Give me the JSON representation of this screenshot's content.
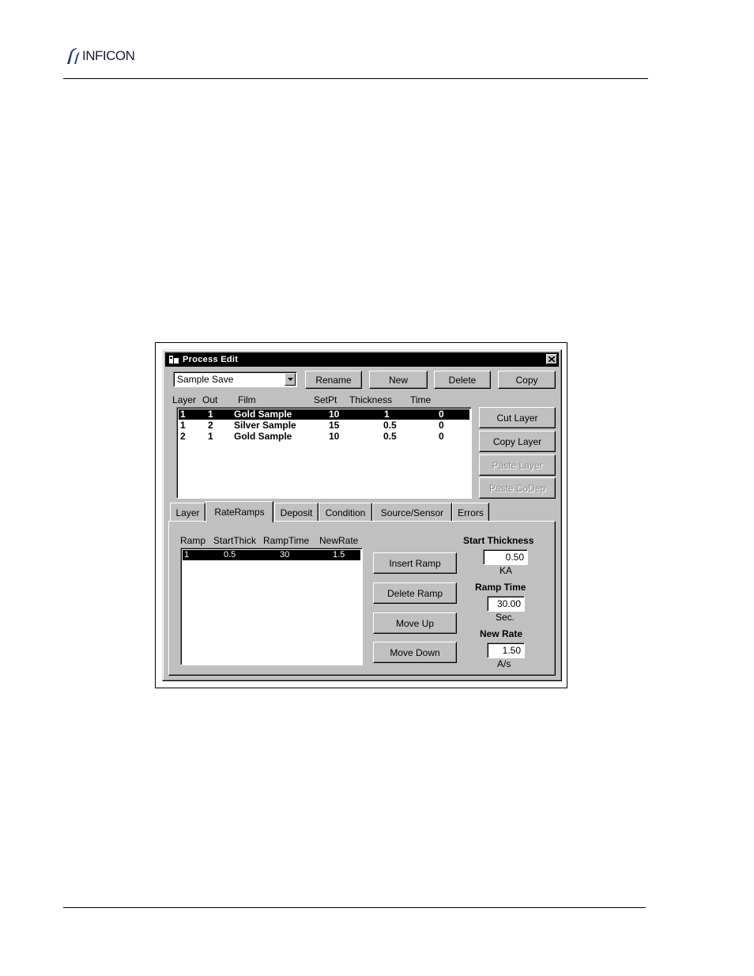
{
  "header": {
    "logo_text": "INFICON"
  },
  "window": {
    "title": "Process Edit",
    "process_select": {
      "value": "Sample Save"
    },
    "top_buttons": {
      "rename": "Rename",
      "new": "New",
      "delete": "Delete",
      "copy": "Copy"
    },
    "layer_table": {
      "headers": [
        "Layer",
        "Out",
        "Film",
        "SetPt",
        "Thickness",
        "Time"
      ],
      "rows": [
        {
          "layer": "1",
          "out": "1",
          "film": "Gold Sample",
          "setpt": "10",
          "thickness": "1",
          "time": "0"
        },
        {
          "layer": "1",
          "out": "2",
          "film": "Silver Sample",
          "setpt": "15",
          "thickness": "0.5",
          "time": "0"
        },
        {
          "layer": "2",
          "out": "1",
          "film": "Gold Sample",
          "setpt": "10",
          "thickness": "0.5",
          "time": "0"
        }
      ]
    },
    "side_buttons": {
      "cut_layer": "Cut Layer",
      "copy_layer": "Copy Layer",
      "paste_layer": "Paste Layer",
      "paste_codep": "Paste CoDep"
    },
    "tabs": [
      "Layer",
      "RateRamps",
      "Deposit",
      "Condition",
      "Source/Sensor",
      "Errors"
    ],
    "active_tab": "RateRamps",
    "ramps": {
      "headers": [
        "Ramp",
        "StartThick",
        "RampTime",
        "NewRate"
      ],
      "rows": [
        {
          "ramp": "1",
          "start_thick": "0.5",
          "ramp_time": "30",
          "new_rate": "1.5"
        }
      ],
      "buttons": {
        "insert": "Insert Ramp",
        "delete": "Delete Ramp",
        "move_up": "Move Up",
        "move_down": "Move Down"
      },
      "fields": {
        "start_thickness": {
          "label": "Start Thickness",
          "value": "0.50",
          "unit": "KA"
        },
        "ramp_time": {
          "label": "Ramp Time",
          "value": "30.00",
          "unit": "Sec."
        },
        "new_rate": {
          "label": "New Rate",
          "value": "1.50",
          "unit": "A/s"
        }
      }
    }
  }
}
